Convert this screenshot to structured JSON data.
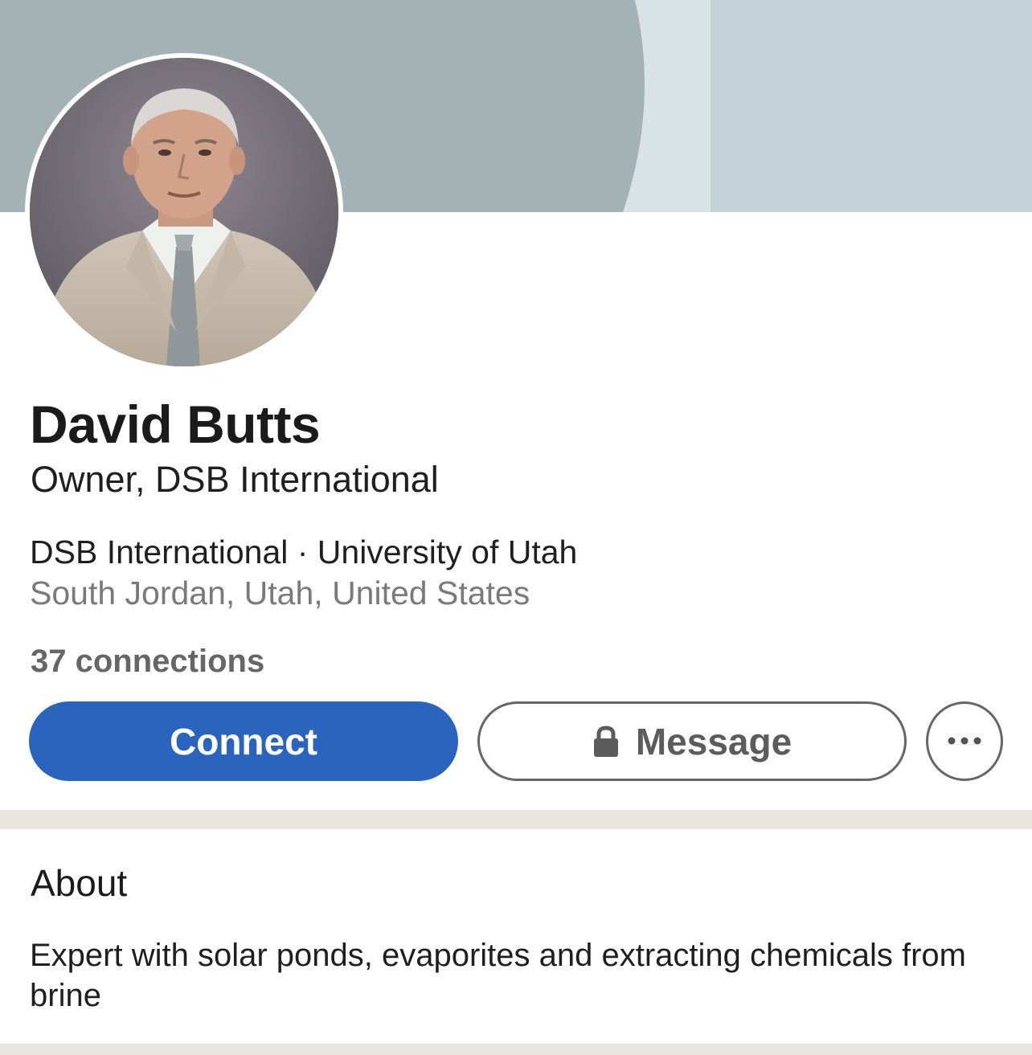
{
  "profile": {
    "name": "David Butts",
    "headline": "Owner, DSB International",
    "org_line": "DSB International · University of Utah",
    "location": "South Jordan, Utah, United States",
    "connections": "37 connections"
  },
  "actions": {
    "connect_label": "Connect",
    "message_label": "Message",
    "more_icon": "more-horizontal-icon",
    "lock_icon": "lock-icon"
  },
  "about": {
    "title": "About",
    "text": "Expert with solar ponds, evaporites and extracting chemicals from brine"
  },
  "colors": {
    "connect_button": "#2b64bf",
    "banner_dark": "#a3b2b5",
    "banner_light": "#c3d2d6",
    "page_background": "#e9e6e1"
  }
}
